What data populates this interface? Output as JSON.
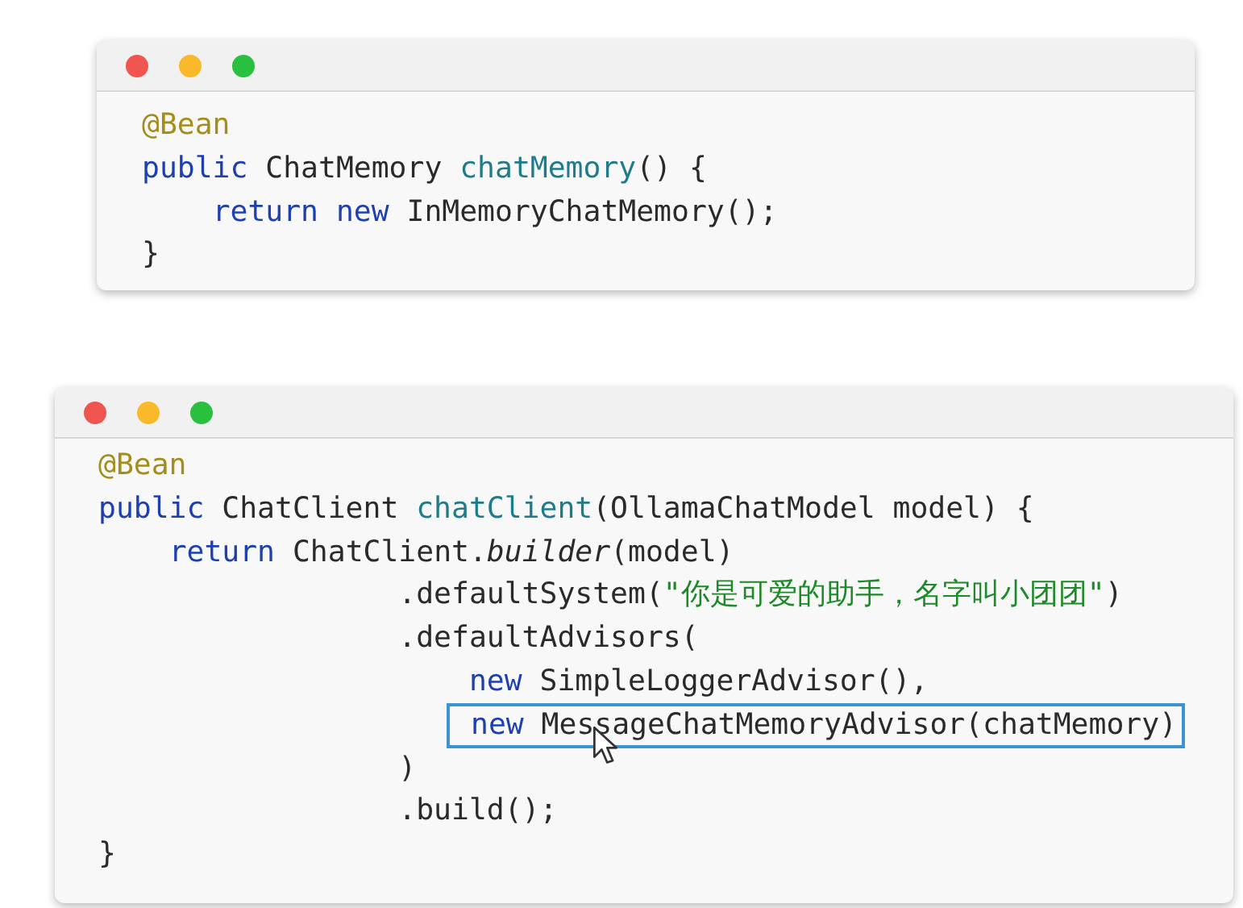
{
  "code_windows": [
    {
      "lines": [
        {
          "highlighted": false,
          "tokens": [
            {
              "kind": "annotation",
              "text": "@Bean"
            }
          ]
        },
        {
          "highlighted": false,
          "tokens": [
            {
              "kind": "keyword",
              "text": "public"
            },
            {
              "kind": "plain",
              "text": " ChatMemory "
            },
            {
              "kind": "method",
              "text": "chatMemory"
            },
            {
              "kind": "plain",
              "text": "() {"
            }
          ]
        },
        {
          "highlighted": false,
          "tokens": [
            {
              "kind": "keyword",
              "text": "    return new"
            },
            {
              "kind": "plain",
              "text": " InMemoryChatMemory();"
            }
          ]
        },
        {
          "highlighted": false,
          "tokens": [
            {
              "kind": "plain",
              "text": "}"
            }
          ]
        }
      ]
    },
    {
      "lines": [
        {
          "highlighted": false,
          "tokens": [
            {
              "kind": "annotation",
              "text": "@Bean"
            }
          ]
        },
        {
          "highlighted": false,
          "tokens": [
            {
              "kind": "keyword",
              "text": "public"
            },
            {
              "kind": "plain",
              "text": " ChatClient "
            },
            {
              "kind": "method",
              "text": "chatClient"
            },
            {
              "kind": "plain",
              "text": "(OllamaChatModel model) {"
            }
          ]
        },
        {
          "highlighted": false,
          "tokens": [
            {
              "kind": "keyword",
              "text": "    return"
            },
            {
              "kind": "plain",
              "text": " ChatClient."
            },
            {
              "kind": "static",
              "text": "builder"
            },
            {
              "kind": "plain",
              "text": "(model)"
            }
          ]
        },
        {
          "highlighted": false,
          "tokens": [
            {
              "kind": "plain",
              "text": "                 .defaultSystem("
            },
            {
              "kind": "string",
              "text": "\"你是可爱的助手，名字叫小团团\""
            },
            {
              "kind": "plain",
              "text": ")"
            }
          ]
        },
        {
          "highlighted": false,
          "tokens": [
            {
              "kind": "plain",
              "text": "                 .defaultAdvisors("
            }
          ]
        },
        {
          "highlighted": false,
          "tokens": [
            {
              "kind": "keyword",
              "text": "                     new"
            },
            {
              "kind": "plain",
              "text": " SimpleLoggerAdvisor(),"
            }
          ]
        },
        {
          "highlighted": true,
          "tokens": [
            {
              "kind": "keyword",
              "text": "                    new"
            },
            {
              "kind": "plain",
              "text": " MessageChatMemoryAdvisor(chatMemory)"
            }
          ]
        },
        {
          "highlighted": false,
          "tokens": [
            {
              "kind": "plain",
              "text": "                 )"
            }
          ]
        },
        {
          "highlighted": false,
          "tokens": [
            {
              "kind": "plain",
              "text": "                 .build();"
            }
          ]
        },
        {
          "highlighted": false,
          "tokens": [
            {
              "kind": "plain",
              "text": "}"
            }
          ]
        }
      ]
    }
  ]
}
